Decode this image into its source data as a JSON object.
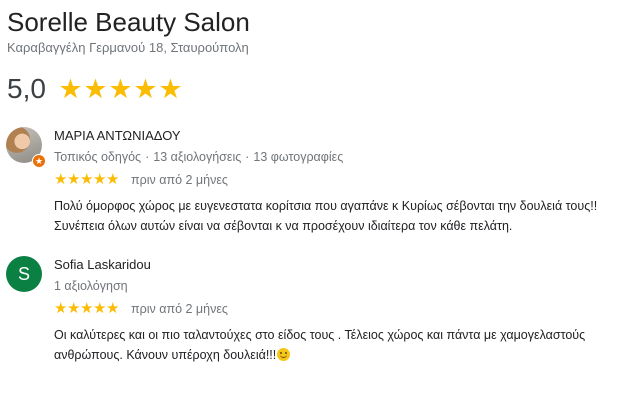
{
  "business": {
    "name": "Sorelle Beauty Salon",
    "address": "Καραβαγγέλη Γερμανού 18, Σταυρούπολη",
    "rating": "5,0",
    "rating_value": 5,
    "star_color": "#fbbc04"
  },
  "reviews": [
    {
      "author": "ΜΑΡΙΑ ΑΝΤΩΝΙΑΔΟΥ",
      "badge": "Τοπικός οδηγός",
      "reviews_count": "13 αξιολογήσεις",
      "photos_count": "13 φωτογραφίες",
      "stars": 5,
      "time": "πριν από 2 μήνες",
      "text": "Πολύ όμορφος χώρος με ευγενεστατα κορίτσια που αγαπάνε κ Κυρίως σέβονται την δουλειά τους!! Συνέπεια όλων αυτών είναι να σέβονται κ να προσέχουν ιδιαίτερα τον κάθε πελάτη.",
      "avatar_icon": "profile-photo-icon"
    },
    {
      "author": "Sofia Laskaridou",
      "avatar_letter": "S",
      "avatar_color": "#0b8043",
      "reviews_count": "1 αξιολόγηση",
      "stars": 5,
      "time": "πριν από 2 μήνες",
      "text": "Οι καλύτερες και οι πιο ταλαντούχες στο είδος τους . Τέλειος χώρος και πάντα με χαμογελαστούς ανθρώπους. Κάνουν υπέροχη δουλειά!!!",
      "text_emoji": "smiling-face-emoji"
    }
  ]
}
